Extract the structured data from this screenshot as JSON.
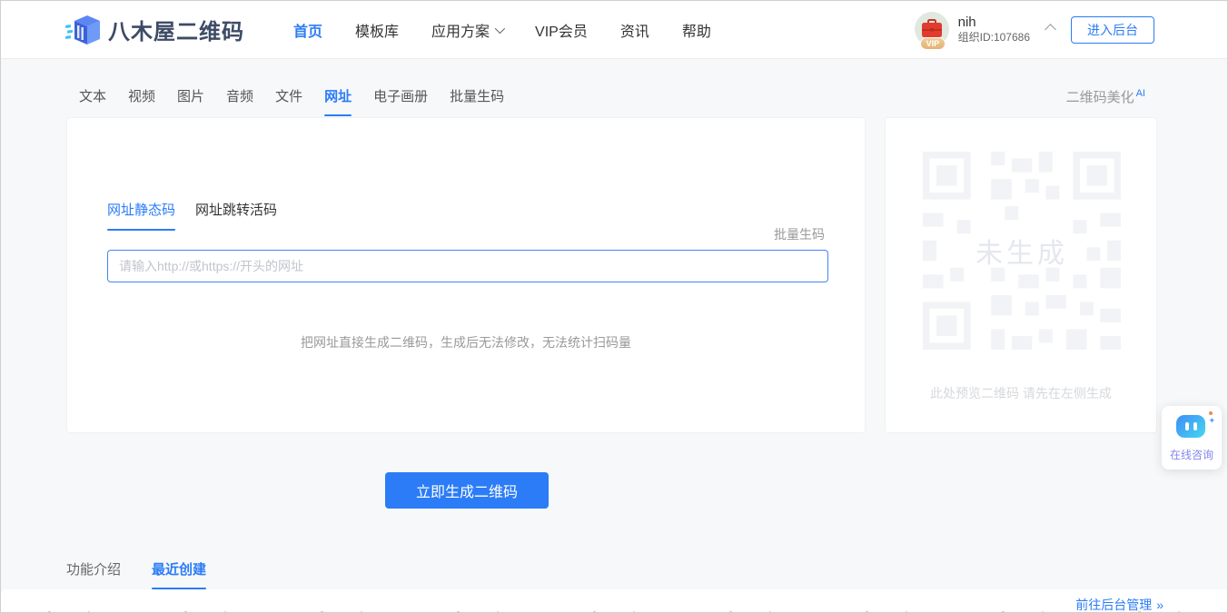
{
  "colors": {
    "accent": "#2b7cf6",
    "logo_text": "#3d4b66",
    "page_bg": "#f7f8fa",
    "vip_badge_bg": "#e9bf85",
    "briefcase_red": "#e23b2e",
    "qr_pattern": "#f4f5f8"
  },
  "header": {
    "logo_text": "八木屋二维码",
    "nav": [
      {
        "label": "首页",
        "active": true
      },
      {
        "label": "模板库"
      },
      {
        "label": "应用方案",
        "dropdown": true
      },
      {
        "label": "VIP会员"
      },
      {
        "label": "资讯"
      },
      {
        "label": "帮助"
      }
    ],
    "user": {
      "name": "nih",
      "org": "组织ID:107686",
      "vip": "VIP"
    },
    "enter_backend": "进入后台"
  },
  "type_tabs": {
    "items": [
      {
        "label": "文本"
      },
      {
        "label": "视频"
      },
      {
        "label": "图片"
      },
      {
        "label": "音频"
      },
      {
        "label": "文件"
      },
      {
        "label": "网址",
        "active": true
      },
      {
        "label": "电子画册"
      },
      {
        "label": "批量生码"
      }
    ],
    "beautify": "二维码美化",
    "beautify_tag": "AI"
  },
  "generator": {
    "sub_tabs": [
      {
        "label": "网址静态码",
        "active": true
      },
      {
        "label": "网址跳转活码"
      }
    ],
    "batch_link": "批量生码",
    "input_value": "",
    "input_placeholder": "请输入http://或https://开头的网址",
    "hint": "把网址直接生成二维码，生成后无法修改，无法统计扫码量",
    "generate_button": "立即生成二维码"
  },
  "preview": {
    "overlay": "未生成",
    "caption": "此处预览二维码 请先在左侧生成"
  },
  "bottom": {
    "tabs": [
      {
        "label": "功能介绍"
      },
      {
        "label": "最近创建",
        "active": true
      }
    ],
    "manage_link": "前往后台管理",
    "manage_arrow": "»"
  },
  "chat": {
    "label": "在线咨询"
  }
}
